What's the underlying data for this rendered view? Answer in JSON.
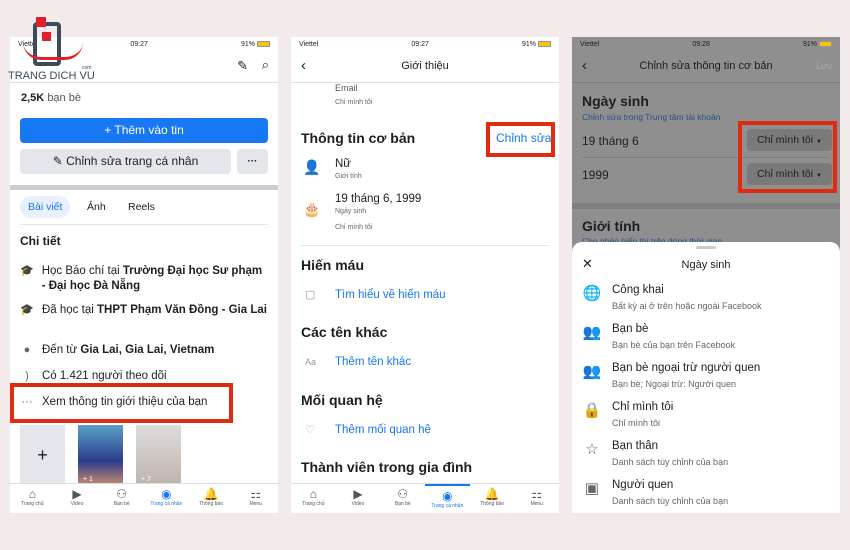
{
  "logo": {
    "text": "TRANG DICH VU",
    "suffix": "com"
  },
  "panel1": {
    "status": {
      "carrier": "Viettel",
      "time": "09:27",
      "battery": "91%"
    },
    "friends_count": "2,5K",
    "friends_label": "bạn bè",
    "add_story": "+ Thêm vào tin",
    "edit_profile": "Chỉnh sửa trang cá nhân",
    "more": "···",
    "tabs": [
      "Bài viết",
      "Ảnh",
      "Reels"
    ],
    "details_title": "Chi tiết",
    "details": [
      {
        "icon": "graduation-cap-icon",
        "text": "Học Báo chí tại ",
        "bold": "Trường Đại học Sư phạm - Đại học Đà Nẵng"
      },
      {
        "icon": "graduation-cap-icon",
        "text": "Đã học tại ",
        "bold": "THPT Phạm Văn Đồng - Gia Lai"
      },
      {
        "icon": "location-pin-icon",
        "text": "Đến từ ",
        "bold": "Gia Lai, Gia Lai, Vietnam"
      },
      {
        "icon": "rss-icon",
        "text": "Có 1.421 người theo dõi",
        "bold": ""
      }
    ],
    "see_about": "Xem thông tin giới thiệu của bạn",
    "story_counts": [
      "+ 1",
      "+ 7"
    ],
    "nav": [
      "Trang chủ",
      "Video",
      "Bạn bè",
      "Trang cá nhân",
      "Thông báo",
      "Menu"
    ]
  },
  "panel2": {
    "status": {
      "carrier": "Viettel",
      "time": "09:27",
      "battery": "91%"
    },
    "title": "Giới thiệu",
    "email_label": "Email",
    "only_me": "Chỉ mình tôi",
    "basic_info": "Thông tin cơ bản",
    "edit": "Chỉnh sửa",
    "gender": "Nữ",
    "gender_label": "Giới tính",
    "birthday": "19 tháng 6, 1999",
    "birthday_label": "Ngày sinh",
    "birthday_privacy": "Chỉ mình tôi",
    "blood": "Hiến máu",
    "blood_link": "Tìm hiểu về hiến máu",
    "other_names": "Các tên khác",
    "other_names_link": "Thêm tên khác",
    "relationship": "Mối quan hệ",
    "relationship_link": "Thêm mối quan hệ",
    "family": "Thành viên trong gia đình",
    "nav": [
      "Trang chủ",
      "Video",
      "Bạn bè",
      "Trang cá nhân",
      "Thông báo",
      "Menu"
    ]
  },
  "panel3": {
    "status": {
      "carrier": "Viettel",
      "time": "09:28",
      "battery": "91%"
    },
    "title": "Chỉnh sửa thông tin cơ bản",
    "save": "Lưu",
    "birthday_title": "Ngày sinh",
    "accounts_center": "Chỉnh sửa trong Trung tâm tài khoản",
    "date": "19 tháng 6",
    "year": "1999",
    "privacy": "Chỉ mình tôi",
    "gender_title": "Giới tính",
    "gender_sub": "Cho phép hiển thị trên dòng thời gian",
    "sheet_title": "Ngày sinh",
    "options": [
      {
        "icon": "globe-icon",
        "label": "Công khai",
        "desc": "Bất kỳ ai ở trên hoặc ngoài Facebook"
      },
      {
        "icon": "friends-icon",
        "label": "Bạn bè",
        "desc": "Bạn bè của bạn trên Facebook"
      },
      {
        "icon": "friends-except-icon",
        "label": "Bạn bè ngoại trừ người quen",
        "desc": "Bạn bè; Ngoại trừ: Người quen"
      },
      {
        "icon": "lock-icon",
        "label": "Chỉ mình tôi",
        "desc": "Chỉ mình tôi"
      },
      {
        "icon": "star-icon",
        "label": "Bạn thân",
        "desc": "Danh sách tùy chỉnh của bạn"
      },
      {
        "icon": "contact-card-icon",
        "label": "Người quen",
        "desc": "Danh sách tùy chỉnh của bạn"
      }
    ]
  },
  "colors": {
    "accent": "#1877f2",
    "highlight": "#e02a12"
  }
}
